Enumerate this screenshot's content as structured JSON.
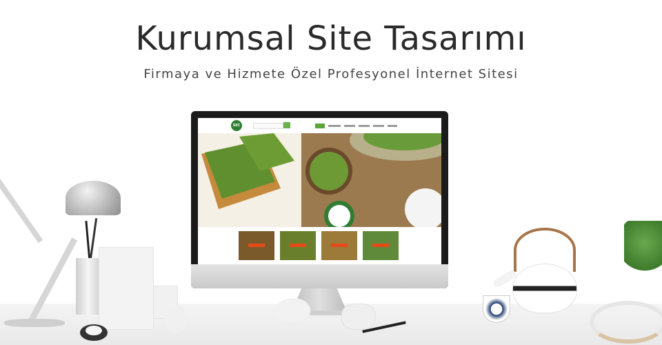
{
  "hero": {
    "title": "Kurumsal Site Tasarımı",
    "subtitle": "Firmaya ve Hizmete Özel Profesyonel İnternet Sitesi"
  },
  "screen_site": {
    "logo_text": "SEC",
    "menu_items": [
      "",
      "",
      "",
      "",
      "",
      ""
    ],
    "thumbnails": [
      {
        "color": "#7a5a2a"
      },
      {
        "color": "#6a7f2c"
      },
      {
        "color": "#9b7a3a"
      },
      {
        "color": "#5f8a3a"
      }
    ]
  },
  "colors": {
    "accent_green": "#5aa63a",
    "text_dark": "#2a2a2a"
  }
}
